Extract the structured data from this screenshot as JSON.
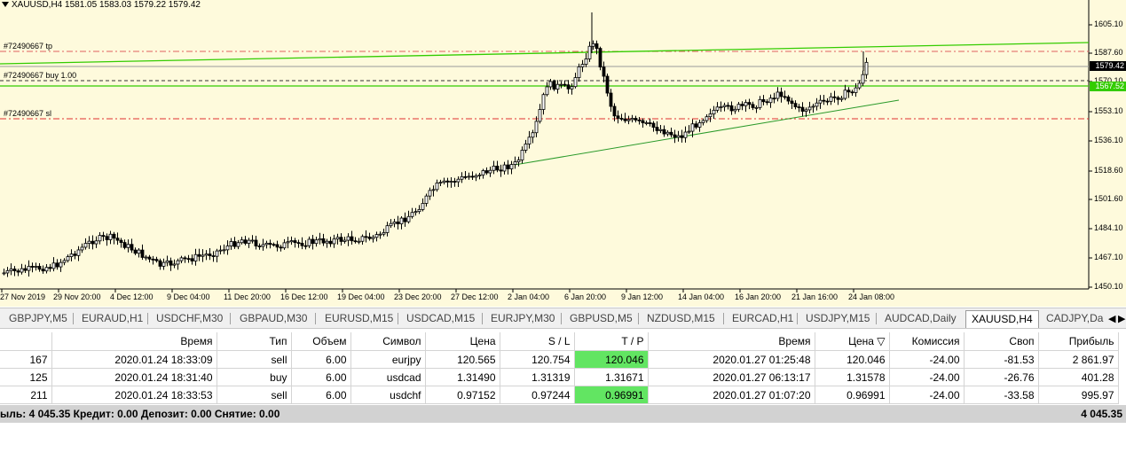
{
  "chart": {
    "header": "XAUUSD,H4  1581.05 1583.03 1579.22 1579.42",
    "line_labels": {
      "tp": "#72490667 tp",
      "buy": "#72490667 buy 1.00",
      "sl": "#72490667 sl"
    },
    "price_axis": [
      "1605.10",
      "1587.60",
      "1570.10",
      "1553.10",
      "1536.10",
      "1518.60",
      "1501.60",
      "1484.10",
      "1467.10",
      "1450.10"
    ],
    "current_price": "1579.42",
    "buy_price": "1567.52",
    "time_axis": [
      "27 Nov 2019",
      "29 Nov 20:00",
      "4 Dec 12:00",
      "9 Dec 04:00",
      "11 Dec 20:00",
      "16 Dec 12:00",
      "19 Dec 04:00",
      "23 Dec 20:00",
      "27 Dec 12:00",
      "2 Jan 04:00",
      "6 Jan 20:00",
      "9 Jan 12:00",
      "14 Jan 04:00",
      "16 Jan 20:00",
      "21 Jan 16:00",
      "24 Jan 08:00"
    ],
    "colors": {
      "background": "#fefadc",
      "candle": "#000000",
      "tp_line": "#e06060",
      "sl_line": "#e03030",
      "buy_line": "#333333",
      "trend": "#2a9a2a",
      "level": "#33cc00"
    }
  },
  "tabs": {
    "items": [
      "GBPJPY,M5",
      "EURAUD,H1",
      "USDCHF,M30",
      "GBPAUD,M30",
      "EURUSD,M15",
      "USDCAD,M15",
      "EURJPY,M30",
      "GBPUSD,M5",
      "NZDUSD,M15",
      "EURCAD,H1",
      "USDJPY,M15",
      "AUDCAD,Daily",
      "XAUUSD,H4",
      "CADJPY,Da"
    ],
    "active": "XAUUSD,H4",
    "prev_arrow": "◀",
    "next_arrow": "▶"
  },
  "table": {
    "headers": [
      "",
      "Время",
      "Тип",
      "Объем",
      "Символ",
      "Цена",
      "S / L",
      "T / P",
      "Время",
      "Цена ▽",
      "Комиссия",
      "Своп",
      "Прибыль"
    ],
    "rows": [
      {
        "id": "167",
        "time": "2020.01.24 18:33:09",
        "type": "sell",
        "volume": "6.00",
        "symbol": "eurjpy",
        "price": "120.565",
        "sl": "120.754",
        "tp": "120.046",
        "close_time": "2020.01.27 01:25:48",
        "close_price": "120.046",
        "commission": "-24.00",
        "swap": "-81.53",
        "profit": "2 861.97"
      },
      {
        "id": "125",
        "time": "2020.01.24 18:31:40",
        "type": "buy",
        "volume": "6.00",
        "symbol": "usdcad",
        "price": "1.31490",
        "sl": "1.31319",
        "tp": "1.31671",
        "close_time": "2020.01.27 06:13:17",
        "close_price": "1.31578",
        "commission": "-24.00",
        "swap": "-26.76",
        "profit": "401.28"
      },
      {
        "id": "211",
        "time": "2020.01.24 18:33:53",
        "type": "sell",
        "volume": "6.00",
        "symbol": "usdchf",
        "price": "0.97152",
        "sl": "0.97244",
        "tp": "0.96991",
        "close_time": "2020.01.27 01:07:20",
        "close_price": "0.96991",
        "commission": "-24.00",
        "swap": "-33.58",
        "profit": "995.97"
      }
    ]
  },
  "summary": {
    "text": "ыль: 4 045.35  Кредит: 0.00  Депозит: 0.00  Снятие: 0.00",
    "total": "4 045.35"
  }
}
